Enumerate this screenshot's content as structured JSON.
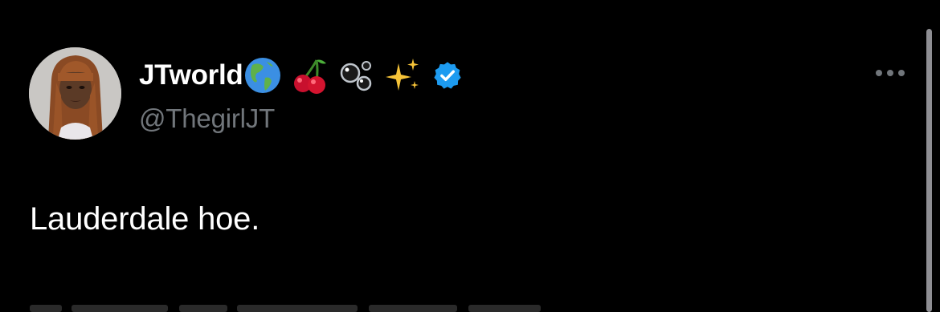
{
  "tweet": {
    "display_name": "JTworld",
    "name_emojis": [
      "globe-americas-emoji",
      "cherries-emoji",
      "bubbles-emoji",
      "sparkles-emoji"
    ],
    "verified": true,
    "handle": "@ThegirlJT",
    "text": "Lauderdale hoe."
  },
  "colors": {
    "background": "#000000",
    "primary_text": "#ffffff",
    "secondary_text": "#71767b",
    "verified_badge": "#1d9bf0"
  },
  "icons": {
    "more": "more-dots-icon",
    "verified": "verified-badge-icon"
  }
}
